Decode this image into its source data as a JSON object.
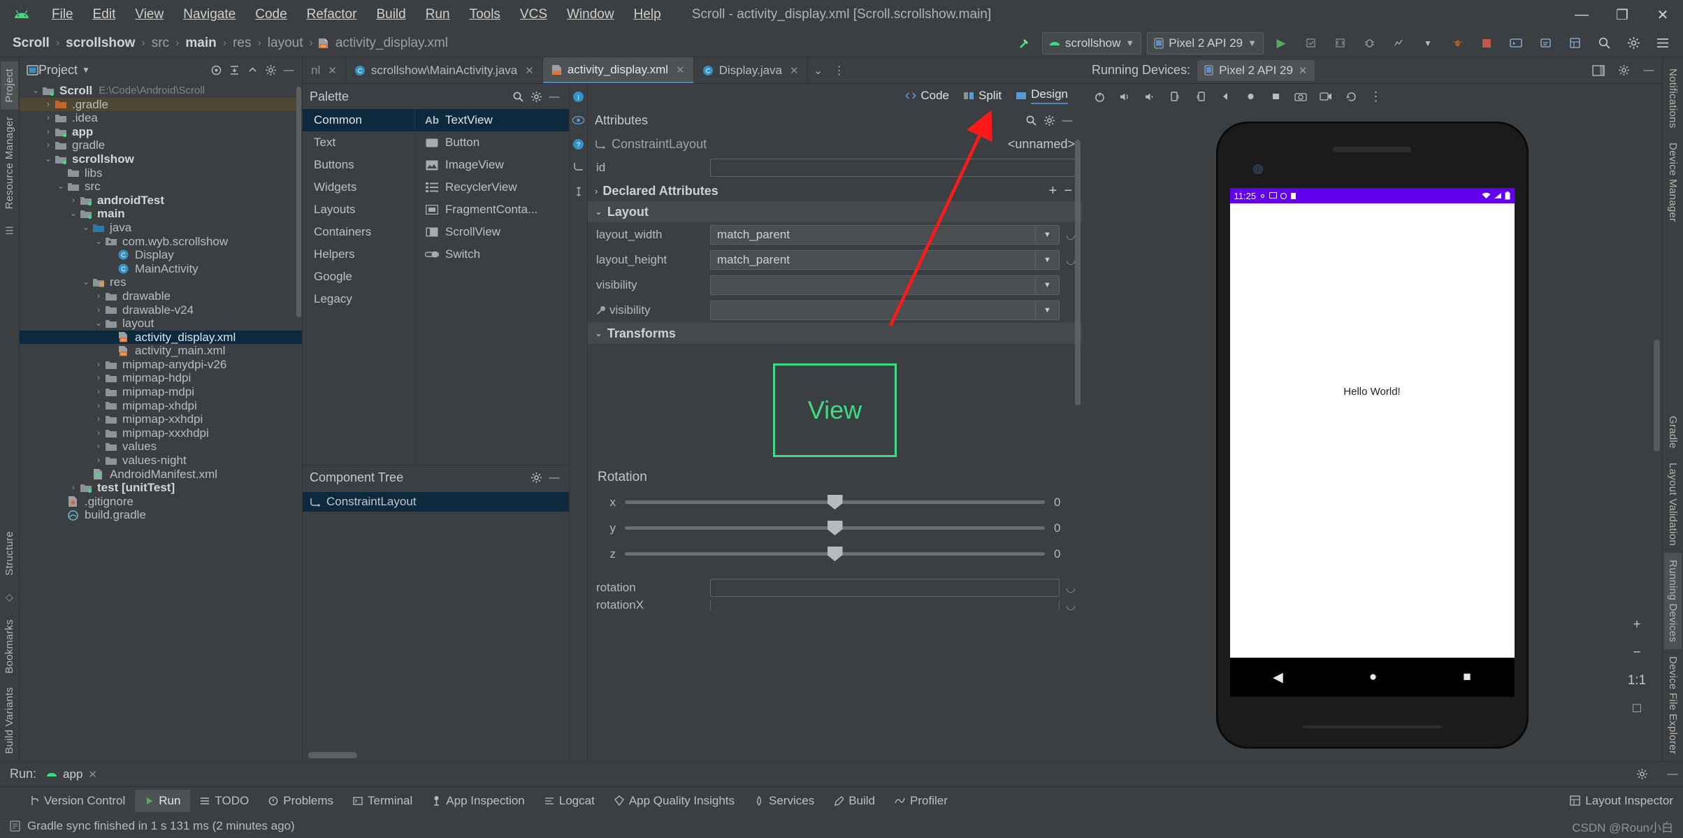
{
  "window": {
    "title": "Scroll - activity_display.xml [Scroll.scrollshow.main]",
    "minimize": "—",
    "maximize": "❐",
    "close": "✕"
  },
  "menubar": {
    "items": [
      "File",
      "Edit",
      "View",
      "Navigate",
      "Code",
      "Refactor",
      "Build",
      "Run",
      "Tools",
      "VCS",
      "Window",
      "Help"
    ]
  },
  "breadcrumb": {
    "items": [
      {
        "label": "Scroll",
        "bold": true
      },
      {
        "label": "scrollshow",
        "bold": true
      },
      {
        "label": "src",
        "bold": false
      },
      {
        "label": "main",
        "bold": true
      },
      {
        "label": "res",
        "bold": false
      },
      {
        "label": "layout",
        "bold": false
      },
      {
        "label": "activity_display.xml",
        "bold": false
      }
    ],
    "separator": "›"
  },
  "navright": {
    "hammer_icon": "build-hammer-icon",
    "module_selector": "scrollshow",
    "device_selector": "Pixel 2 API 29",
    "run_icon": "▶",
    "apply_changes_icon": "apply-changes-icon",
    "apply_code_icon": "apply-code-changes-icon",
    "debug_icon": "debug-icon",
    "profile_icon": "profile-icon",
    "more_run_icon": "more-run-icon",
    "attach_icon": "attach-debugger-icon",
    "stop_icon": "stop-icon",
    "avd_icon": "avd-manager-icon",
    "sdk_icon": "sdk-manager-icon",
    "layout_inspector_icon": "layout-inspector-icon",
    "search_icon": "🔍",
    "settings_icon": "gear-icon",
    "menu_icon": "hamburger-icon"
  },
  "left_rail": {
    "tabs": [
      "Project",
      "Resource Manager"
    ],
    "bottom_tabs": [
      "Structure",
      "Bookmarks",
      "Build Variants"
    ]
  },
  "right_rail": {
    "tabs": [
      "Notifications",
      "Device Manager",
      "Gradle",
      "Layout Validation",
      "Running Devices",
      "Device File Explorer"
    ]
  },
  "project_panel": {
    "title": "Project",
    "chevron": "▼",
    "toolbar_icons": [
      "target-icon",
      "collapse-all-icon",
      "expand-icon",
      "gear-icon",
      "minimize-icon"
    ],
    "tree": [
      {
        "indent": 0,
        "arrow": "⌄",
        "icon": "module",
        "label": "Scroll",
        "bold": true,
        "sub": "E:\\Code\\Android\\Scroll",
        "state": "normal"
      },
      {
        "indent": 1,
        "arrow": "›",
        "icon": "folder-orange",
        "label": ".gradle",
        "bold": false,
        "sub": "",
        "state": "hl"
      },
      {
        "indent": 1,
        "arrow": "›",
        "icon": "folder",
        "label": ".idea",
        "bold": false,
        "sub": "",
        "state": "normal"
      },
      {
        "indent": 1,
        "arrow": "›",
        "icon": "module",
        "label": "app",
        "bold": true,
        "sub": "",
        "state": "normal"
      },
      {
        "indent": 1,
        "arrow": "›",
        "icon": "folder",
        "label": "gradle",
        "bold": false,
        "sub": "",
        "state": "normal"
      },
      {
        "indent": 1,
        "arrow": "⌄",
        "icon": "module",
        "label": "scrollshow",
        "bold": true,
        "sub": "",
        "state": "normal"
      },
      {
        "indent": 2,
        "arrow": "",
        "icon": "folder",
        "label": "libs",
        "bold": false,
        "sub": "",
        "state": "normal"
      },
      {
        "indent": 2,
        "arrow": "⌄",
        "icon": "folder",
        "label": "src",
        "bold": false,
        "sub": "",
        "state": "normal"
      },
      {
        "indent": 3,
        "arrow": "›",
        "icon": "module",
        "label": "androidTest",
        "bold": true,
        "sub": "",
        "state": "normal"
      },
      {
        "indent": 3,
        "arrow": "⌄",
        "icon": "module",
        "label": "main",
        "bold": true,
        "sub": "",
        "state": "normal"
      },
      {
        "indent": 4,
        "arrow": "⌄",
        "icon": "folder-src",
        "label": "java",
        "bold": false,
        "sub": "",
        "state": "normal"
      },
      {
        "indent": 5,
        "arrow": "⌄",
        "icon": "package",
        "label": "com.wyb.scrollshow",
        "bold": false,
        "sub": "",
        "state": "normal"
      },
      {
        "indent": 6,
        "arrow": "",
        "icon": "class",
        "label": "Display",
        "bold": false,
        "sub": "",
        "state": "normal"
      },
      {
        "indent": 6,
        "arrow": "",
        "icon": "class",
        "label": "MainActivity",
        "bold": false,
        "sub": "",
        "state": "normal"
      },
      {
        "indent": 4,
        "arrow": "⌄",
        "icon": "folder-res",
        "label": "res",
        "bold": false,
        "sub": "",
        "state": "normal"
      },
      {
        "indent": 5,
        "arrow": "›",
        "icon": "folder",
        "label": "drawable",
        "bold": false,
        "sub": "",
        "state": "normal"
      },
      {
        "indent": 5,
        "arrow": "›",
        "icon": "folder",
        "label": "drawable-v24",
        "bold": false,
        "sub": "",
        "state": "normal"
      },
      {
        "indent": 5,
        "arrow": "⌄",
        "icon": "folder",
        "label": "layout",
        "bold": false,
        "sub": "",
        "state": "normal"
      },
      {
        "indent": 6,
        "arrow": "",
        "icon": "xml",
        "label": "activity_display.xml",
        "bold": false,
        "sub": "",
        "state": "sel"
      },
      {
        "indent": 6,
        "arrow": "",
        "icon": "xml",
        "label": "activity_main.xml",
        "bold": false,
        "sub": "",
        "state": "normal"
      },
      {
        "indent": 5,
        "arrow": "›",
        "icon": "folder",
        "label": "mipmap-anydpi-v26",
        "bold": false,
        "sub": "",
        "state": "normal"
      },
      {
        "indent": 5,
        "arrow": "›",
        "icon": "folder",
        "label": "mipmap-hdpi",
        "bold": false,
        "sub": "",
        "state": "normal"
      },
      {
        "indent": 5,
        "arrow": "›",
        "icon": "folder",
        "label": "mipmap-mdpi",
        "bold": false,
        "sub": "",
        "state": "normal"
      },
      {
        "indent": 5,
        "arrow": "›",
        "icon": "folder",
        "label": "mipmap-xhdpi",
        "bold": false,
        "sub": "",
        "state": "normal"
      },
      {
        "indent": 5,
        "arrow": "›",
        "icon": "folder",
        "label": "mipmap-xxhdpi",
        "bold": false,
        "sub": "",
        "state": "normal"
      },
      {
        "indent": 5,
        "arrow": "›",
        "icon": "folder",
        "label": "mipmap-xxxhdpi",
        "bold": false,
        "sub": "",
        "state": "normal"
      },
      {
        "indent": 5,
        "arrow": "›",
        "icon": "folder",
        "label": "values",
        "bold": false,
        "sub": "",
        "state": "normal"
      },
      {
        "indent": 5,
        "arrow": "›",
        "icon": "folder",
        "label": "values-night",
        "bold": false,
        "sub": "",
        "state": "normal"
      },
      {
        "indent": 4,
        "arrow": "",
        "icon": "manifest",
        "label": "AndroidManifest.xml",
        "bold": false,
        "sub": "",
        "state": "normal"
      },
      {
        "indent": 3,
        "arrow": "›",
        "icon": "module-test",
        "label": "test [unitTest]",
        "bold": true,
        "sub": "",
        "state": "normal"
      },
      {
        "indent": 2,
        "arrow": "",
        "icon": "gitignore",
        "label": ".gitignore",
        "bold": false,
        "sub": "",
        "state": "normal"
      },
      {
        "indent": 2,
        "arrow": "",
        "icon": "gradle-file",
        "label": "build.gradle",
        "bold": false,
        "sub": "",
        "state": "normal"
      }
    ]
  },
  "editor_tabs": {
    "partial_left": "nl",
    "tabs": [
      {
        "icon": "java-class-icon",
        "label": "scrollshow\\MainActivity.java",
        "active": false
      },
      {
        "icon": "xml-layout-icon",
        "label": "activity_display.xml",
        "active": true
      },
      {
        "icon": "java-class-icon",
        "label": "Display.java",
        "active": false
      }
    ],
    "close_glyph": "✕",
    "overflow_glyph": "⌄",
    "more_glyph": "⋮"
  },
  "design_toolbar": {
    "modes": [
      {
        "label": "Code",
        "icon": "code-mode-icon",
        "selected": false
      },
      {
        "label": "Split",
        "icon": "split-mode-icon",
        "selected": false
      },
      {
        "label": "Design",
        "icon": "design-mode-icon",
        "selected": true
      }
    ]
  },
  "palette": {
    "title": "Palette",
    "search_icon": "🔍",
    "gear_icon": "gear-icon",
    "minimize_icon": "—",
    "categories": [
      "Common",
      "Text",
      "Buttons",
      "Widgets",
      "Layouts",
      "Containers",
      "Helpers",
      "Google",
      "Legacy"
    ],
    "selected_category": "Common",
    "items": [
      {
        "icon": "Ab",
        "label": "TextView",
        "selected": true
      },
      {
        "icon": "button-icon",
        "label": "Button",
        "selected": false
      },
      {
        "icon": "image-icon",
        "label": "ImageView",
        "selected": false
      },
      {
        "icon": "list-icon",
        "label": "RecyclerView",
        "selected": false
      },
      {
        "icon": "fragment-icon",
        "label": "FragmentConta...",
        "selected": false
      },
      {
        "icon": "scrollview-icon",
        "label": "ScrollView",
        "selected": false
      },
      {
        "icon": "switch-icon",
        "label": "Switch",
        "selected": false
      }
    ]
  },
  "component_tree": {
    "title": "Component Tree",
    "gear_icon": "gear-icon",
    "minimize_icon": "—",
    "nodes": [
      {
        "icon": "constraintlayout-icon",
        "label": "ConstraintLayout",
        "selected": true
      }
    ]
  },
  "canvas_strip": {
    "icons": [
      "info-icon",
      "eye-icon",
      "help-icon",
      "constraints-icon",
      "margins-icon"
    ]
  },
  "attributes": {
    "title": "Attributes",
    "search_icon": "🔍",
    "gear_icon": "gear-icon",
    "minimize_icon": "—",
    "component_type": "ConstraintLayout",
    "component_name": "<unnamed>",
    "id_label": "id",
    "id_value": "",
    "declared_attributes": {
      "label": "Declared Attributes",
      "add": "+",
      "remove": "−",
      "chevron": "›"
    },
    "layout_section": {
      "label": "Layout",
      "chevron": "⌄"
    },
    "rows": [
      {
        "label": "layout_width",
        "value": "match_parent",
        "type": "select",
        "wrench": false
      },
      {
        "label": "layout_height",
        "value": "match_parent",
        "type": "select",
        "wrench": false
      },
      {
        "label": "visibility",
        "value": "",
        "type": "select",
        "wrench": false
      },
      {
        "label": "visibility",
        "value": "",
        "type": "select",
        "wrench": true
      }
    ],
    "transforms_section": {
      "label": "Transforms",
      "chevron": "⌄"
    },
    "view_preview_label": "View",
    "rotation_label": "Rotation",
    "rotation_sliders": [
      {
        "axis": "x",
        "value": "0"
      },
      {
        "axis": "y",
        "value": "0"
      },
      {
        "axis": "z",
        "value": "0"
      }
    ],
    "bottom_rows": [
      {
        "label": "rotation",
        "value": ""
      },
      {
        "label": "rotationX",
        "value": ""
      }
    ]
  },
  "running_devices": {
    "label": "Running Devices:",
    "tab_label": "Pixel 2 API 29",
    "tab_close": "✕",
    "window_icon": "split-window-icon",
    "gear_icon": "gear-icon",
    "minimize_icon": "—",
    "toolbar_icons": [
      "power-icon",
      "volume-up-icon",
      "volume-down-icon",
      "rotate-left-icon",
      "rotate-right-icon",
      "back-icon",
      "home-icon",
      "overview-icon",
      "screenshot-icon",
      "record-icon",
      "history-icon",
      "more-icon"
    ],
    "zoom_controls": {
      "zoom_in": "+",
      "zoom_out": "−",
      "zoom_actual": "1:1",
      "zoom_fit": "□"
    },
    "device_screen": {
      "status_time": "11:25",
      "status_left_icons": [
        "gear-icon",
        "cast-icon",
        "sync-icon",
        "debug-icon"
      ],
      "status_right_icons": [
        "wifi-icon",
        "signal-icon",
        "battery-icon"
      ],
      "content_text": "Hello World!",
      "nav_back": "◀",
      "nav_home": "●",
      "nav_recents": "■"
    }
  },
  "run_panel": {
    "label": "Run:",
    "tab_label": "app",
    "tab_icon": "android-icon",
    "tab_close": "✕",
    "gear_icon": "gear-icon",
    "minimize_icon": "—"
  },
  "tool_windows": {
    "buttons": [
      {
        "icon": "version-control-icon",
        "label": "Version Control",
        "selected": false
      },
      {
        "icon": "run-icon",
        "label": "Run",
        "selected": true
      },
      {
        "icon": "todo-icon",
        "label": "TODO",
        "selected": false
      },
      {
        "icon": "problems-icon",
        "label": "Problems",
        "selected": false
      },
      {
        "icon": "terminal-icon",
        "label": "Terminal",
        "selected": false
      },
      {
        "icon": "app-inspection-icon",
        "label": "App Inspection",
        "selected": false
      },
      {
        "icon": "logcat-icon",
        "label": "Logcat",
        "selected": false
      },
      {
        "icon": "app-quality-insights-icon",
        "label": "App Quality Insights",
        "selected": false
      },
      {
        "icon": "services-icon",
        "label": "Services",
        "selected": false
      },
      {
        "icon": "build-icon",
        "label": "Build",
        "selected": false
      },
      {
        "icon": "profiler-icon",
        "label": "Profiler",
        "selected": false
      }
    ],
    "right_button": {
      "icon": "layout-inspector-icon",
      "label": "Layout Inspector"
    }
  },
  "status_bar": {
    "icon": "event-log-icon",
    "message": "Gradle sync finished in 1 s 131 ms (2 minutes ago)",
    "watermark": "CSDN @Roun小白"
  },
  "colors": {
    "accent": "#4a88c7",
    "selection": "#0d293e",
    "android_green": "#3ddc84",
    "arrow_red": "#ff1a1a",
    "purple_status": "#6200ee",
    "panel_bg": "#3c3f41"
  }
}
